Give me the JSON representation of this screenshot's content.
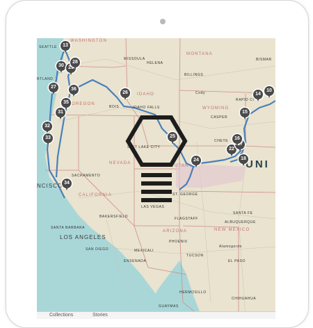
{
  "colors": {
    "ocean": "#a9d7d8",
    "land": "#e9e3cf",
    "route": "#4a7fb8",
    "state_label": "#c76f6a",
    "pin": "#4a4a4a"
  },
  "states": [
    {
      "id": "washington",
      "label": "WASHINGTON"
    },
    {
      "id": "montana",
      "label": "MONTANA"
    },
    {
      "id": "oregon",
      "label": "OREGON"
    },
    {
      "id": "idaho",
      "label": "IDAHO"
    },
    {
      "id": "wyoming",
      "label": "WYOMING"
    },
    {
      "id": "nevada",
      "label": "NEVADA"
    },
    {
      "id": "utah",
      "label": "UTAH"
    },
    {
      "id": "california",
      "label": "CALIFORNIA"
    },
    {
      "id": "arizona",
      "label": "ARIZONA"
    },
    {
      "id": "new-mexico",
      "label": "NEW MEXICO"
    }
  ],
  "cities": [
    {
      "id": "seattle",
      "label": "SEATTLE"
    },
    {
      "id": "missoula",
      "label": "MISSOULA"
    },
    {
      "id": "helena",
      "label": "HELENA"
    },
    {
      "id": "billings",
      "label": "BILLINGS"
    },
    {
      "id": "bismarck",
      "label": "BISMAR"
    },
    {
      "id": "portland",
      "label": "RTLAND"
    },
    {
      "id": "cody",
      "label": "Cody"
    },
    {
      "id": "rapid-city",
      "label": "RAPID CI"
    },
    {
      "id": "boise",
      "label": "BOIS"
    },
    {
      "id": "idaho-falls",
      "label": "IDAHO FALLS"
    },
    {
      "id": "casper",
      "label": "CASPER"
    },
    {
      "id": "cheyenne",
      "label": "CHEYE"
    },
    {
      "id": "salt-lake-city",
      "label": "SALT LAKE CITY"
    },
    {
      "id": "sacramento",
      "label": "SACRAMENTO"
    },
    {
      "id": "san-francisco",
      "label": "NCISCO"
    },
    {
      "id": "st-george",
      "label": "ST. GEORGE"
    },
    {
      "id": "las-vegas",
      "label": "LAS VEGAS"
    },
    {
      "id": "bakersfield",
      "label": "BAKERSFIELD"
    },
    {
      "id": "santa-barbara",
      "label": "SANTA BARBARA"
    },
    {
      "id": "los-angeles",
      "label": "LOS ANGELES"
    },
    {
      "id": "flagstaff",
      "label": "FLAGSTAFF"
    },
    {
      "id": "santa-fe",
      "label": "SANTA FE"
    },
    {
      "id": "albuquerque",
      "label": "ALBUQUERQUE"
    },
    {
      "id": "phoenix",
      "label": "PHOENIX"
    },
    {
      "id": "san-diego",
      "label": "SAN DIEGO"
    },
    {
      "id": "mexicali",
      "label": "MEXICALI"
    },
    {
      "id": "alamogordo",
      "label": "Alamogordo"
    },
    {
      "id": "tucson",
      "label": "TUCSON"
    },
    {
      "id": "ensenada",
      "label": "ENSENADA"
    },
    {
      "id": "el-paso",
      "label": "EL PASO"
    },
    {
      "id": "guaymas",
      "label": "GUAYMAS"
    },
    {
      "id": "hermosillo",
      "label": "HERMOSILLO"
    },
    {
      "id": "chihuahua",
      "label": "CHIHUAHUA"
    },
    {
      "id": "united-states",
      "label": "UNI"
    },
    {
      "id": "denver-partial",
      "label": "R"
    }
  ],
  "pins": [
    "13",
    "30",
    "29",
    "28",
    "27",
    "36",
    "35",
    "31",
    "32",
    "33",
    "34",
    "26",
    "25",
    "24",
    "22",
    "17",
    "18",
    "16",
    "15",
    "14",
    "10"
  ],
  "footer": {
    "tab_collections": "Collections",
    "tab_stories": "Stories"
  }
}
